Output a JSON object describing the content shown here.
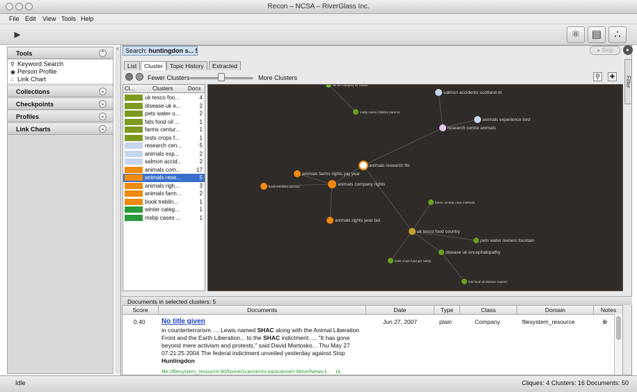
{
  "window": {
    "title": "Recon – NCSA – RiverGlass Inc."
  },
  "menu": [
    "File",
    "Edit",
    "View",
    "Tools",
    "Help"
  ],
  "toolbar": {
    "left_icon": "recon-logo-icon",
    "right_icons": [
      "keyword-search-icon",
      "document-icon",
      "link-chart-icon"
    ]
  },
  "left_panel": {
    "tools_label": "Tools",
    "tools": [
      {
        "icon": "magnifier-person-icon",
        "label": "Keyword Search"
      },
      {
        "icon": "person-profile-icon",
        "label": "Person Profile"
      },
      {
        "icon": "link-chart-icon",
        "label": "Link Chart"
      }
    ],
    "sections": [
      "Collections",
      "Checkpoints",
      "Profiles",
      "Link Charts"
    ]
  },
  "search_tab": {
    "prefix": "Search: ",
    "query": "huntingdon s...",
    "count": "50"
  },
  "stop_label": "Stop",
  "tabs": [
    "List",
    "Cluster",
    "Topic History",
    "Extracted"
  ],
  "active_tab": "Cluster",
  "slider": {
    "fewer": "Fewer Clusters",
    "more": "More Clusters",
    "value": 0.5
  },
  "filter_label": "Filter",
  "clusters": {
    "headers": [
      "Cl...",
      "Clusters",
      "Docs"
    ],
    "rows": [
      {
        "color": "#7d9a20",
        "name": "uk tesco foo...",
        "docs": "4"
      },
      {
        "color": "#7d9a20",
        "name": "disease uk e...",
        "docs": "2"
      },
      {
        "color": "#7d9a20",
        "name": "pets water o...",
        "docs": "2"
      },
      {
        "color": "#7d9a20",
        "name": "fats food oil ...",
        "docs": "1"
      },
      {
        "color": "#7d9a20",
        "name": "farms centur...",
        "docs": "1"
      },
      {
        "color": "#7d9a20",
        "name": "tests crops f...",
        "docs": "1"
      },
      {
        "color": "#c5d6ee",
        "name": "research cen...",
        "docs": "5"
      },
      {
        "color": "#c5d6ee",
        "name": "animals exp...",
        "docs": "2"
      },
      {
        "color": "#c5d6ee",
        "name": "salmon accid...",
        "docs": "2"
      },
      {
        "color": "#f08a10",
        "name": "animals com...",
        "docs": "17"
      },
      {
        "color": "#f08a10",
        "name": "animals rese...",
        "docs": "5",
        "selected": true
      },
      {
        "color": "#f08a10",
        "name": "animals righ...",
        "docs": "3"
      },
      {
        "color": "#f08a10",
        "name": "animals farm...",
        "docs": "2"
      },
      {
        "color": "#f08a10",
        "name": "book treblin...",
        "docs": "1"
      },
      {
        "color": "#2a9a3a",
        "name": "winter categ...",
        "docs": "1"
      },
      {
        "color": "#2a9a3a",
        "name": "msbp cases ...",
        "docs": "1"
      }
    ]
  },
  "graph": {
    "nodes": [
      {
        "label": "winter category uk medal",
        "color": "#7ab030"
      },
      {
        "label": "msbp cases children parents",
        "color": "#6aa020"
      },
      {
        "label": "salmon accidents scotland dr",
        "color": "#c5d6ee"
      },
      {
        "label": "animals experience lord",
        "color": "#c5d6ee"
      },
      {
        "label": "research centre animals",
        "color": "#e6c8e6"
      },
      {
        "label": "animals research fbi",
        "color": "#ffffff"
      },
      {
        "label": "animals farms rights pig year",
        "color": "#f08a10"
      },
      {
        "label": "book treblinka animals",
        "color": "#f08a10"
      },
      {
        "label": "animals company rights",
        "color": "#f08a10"
      },
      {
        "label": "farms century cows methods",
        "color": "#6aa020"
      },
      {
        "label": "animals rights year bid",
        "color": "#f08a10"
      },
      {
        "label": "uk tesco food country",
        "color": "#c8a030"
      },
      {
        "label": "pets water owners fountain",
        "color": "#6aa020"
      },
      {
        "label": "disease uk encephalopathy",
        "color": "#6aa020"
      },
      {
        "label": "tests crops food gm safety",
        "color": "#6aa020"
      },
      {
        "label": "fats food oil disease experts",
        "color": "#6aa020"
      }
    ]
  },
  "documents": {
    "bar_label": "Documents in selected clusters: 5",
    "headers": [
      "Score",
      "Documents",
      "Date",
      "Type",
      "Class",
      "Domain",
      "Notes"
    ],
    "rows": [
      {
        "score": "0.40",
        "title": "No title given",
        "snippet_1": "in counterterrorism. ... Lewis named ",
        "shac_1": "SHAC",
        "snippet_2": " along with the Animal Liberation Front and the Earth Liberation... to the ",
        "shac_2": "SHAC",
        "snippet_3": " indictment. ... \"It has gone beyond mere activism and protests,\" said David Martosko... Thu May 27 07:21:25 2004 The federal indictment unveiled yesterday against Stop ",
        "huntingdon": "Huntingdon",
        "url": "file://filesystem_resource:80/home/scanner/ncsa/scanner/.ldrive/News-t...",
        "size": "1k",
        "date": "Jun 27, 2007",
        "type": "plain",
        "class": "Company",
        "domain": "filesystem_resource"
      }
    ]
  },
  "status": {
    "left": "Idle",
    "right": "Cliques: 4  Clusters: 16  Documents: 50"
  }
}
